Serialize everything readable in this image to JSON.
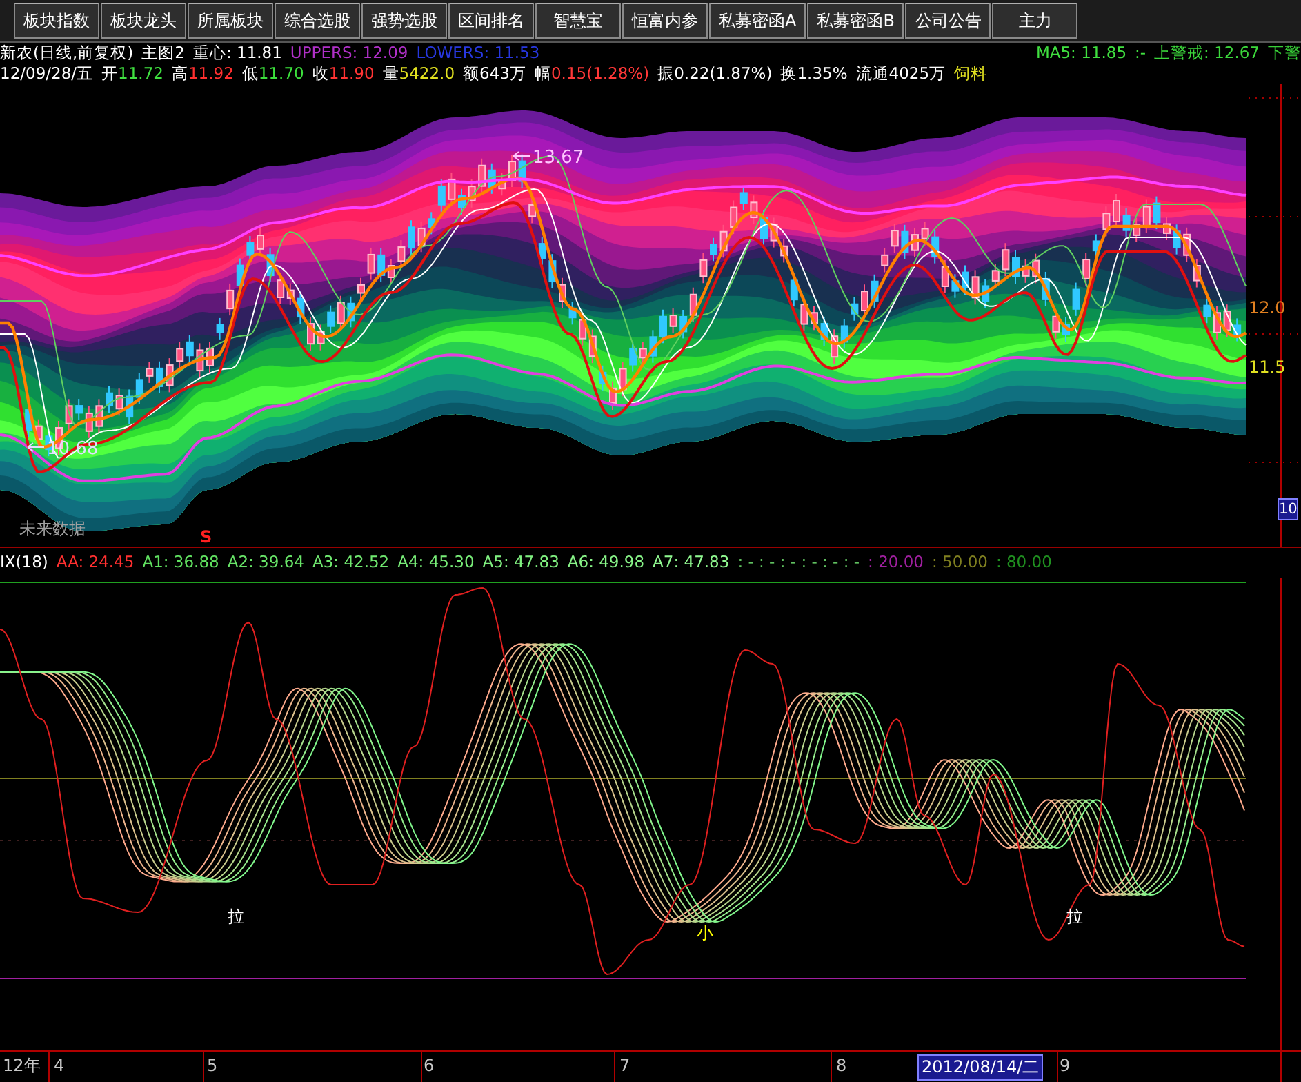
{
  "toolbar": {
    "buttons": [
      {
        "label": "板块指数"
      },
      {
        "label": "板块龙头"
      },
      {
        "label": "所属板块"
      },
      {
        "label": "综合选股"
      },
      {
        "label": "强势选股"
      },
      {
        "label": "区间排名"
      },
      {
        "label": "智慧宝"
      },
      {
        "label": "恒富内参"
      },
      {
        "label": "私募密函A"
      },
      {
        "label": "私募密函B"
      },
      {
        "label": "公司公告"
      },
      {
        "label": "主力"
      }
    ]
  },
  "quote_header": {
    "title": "新农(日线,前复权)",
    "chart_name": "主图2",
    "indicators": [
      {
        "text": "重心: 11.81",
        "color": "#ffffff"
      },
      {
        "text": "UPPERS: 12.09",
        "color": "#b030c8"
      },
      {
        "text": "LOWERS: 11.53",
        "color": "#2838e0"
      }
    ],
    "alerts": [
      {
        "text": "MA5: 11.85",
        "color": "#40e040"
      },
      {
        "text": ":-",
        "color": "#40e040"
      },
      {
        "text": "上警戒: 12.67",
        "color": "#3cd83c"
      },
      {
        "text": "下警",
        "color": "#38d038"
      }
    ]
  },
  "quote_line": {
    "date": "12/09/28/五",
    "fields": [
      {
        "label": "开",
        "value": "11.72",
        "color": "#40e040"
      },
      {
        "label": "高",
        "value": "11.92",
        "color": "#ff3030"
      },
      {
        "label": "低",
        "value": "11.70",
        "color": "#3ce03c"
      },
      {
        "label": "收",
        "value": "11.90",
        "color": "#ff3434"
      },
      {
        "label": "量",
        "value": "5422.0",
        "color": "#e0e020"
      },
      {
        "label": "额",
        "value": "643万",
        "color": "#ffffff"
      },
      {
        "label": "幅",
        "value": "0.15(1.28%)",
        "color": "#ff3838"
      },
      {
        "label": "振",
        "value": "0.22(1.87%)",
        "color": "#fefefe"
      },
      {
        "label": "换",
        "value": "1.35%",
        "color": "#fdfdfd"
      },
      {
        "label": "流通",
        "value": "4025万",
        "color": "#fcfcfc"
      }
    ],
    "industry": "饲料"
  },
  "main_chart": {
    "annotations": [
      {
        "kind": "high",
        "text": "13.67"
      },
      {
        "kind": "low",
        "text": "10.68"
      },
      {
        "kind": "note",
        "text": "未来数据"
      },
      {
        "kind": "signal",
        "text": "S"
      }
    ],
    "axis_labels": [
      {
        "text": "12.0",
        "color": "#e08020"
      },
      {
        "text": "11.5",
        "color": "#e0e020"
      }
    ],
    "current_value": "10"
  },
  "indicator": {
    "name": "IX(18)",
    "readings": [
      {
        "text": "AA: 24.45",
        "color": "#ff3030"
      },
      {
        "text": "A1: 36.88",
        "color": "#60e060"
      },
      {
        "text": "A2: 39.64",
        "color": "#68e468"
      },
      {
        "text": "A3: 42.52",
        "color": "#70e870"
      },
      {
        "text": "A4: 45.30",
        "color": "#78ec78"
      },
      {
        "text": "A5: 47.83",
        "color": "#80f080"
      },
      {
        "text": "A6: 49.98",
        "color": "#88f488"
      },
      {
        "text": "A7: 47.83",
        "color": "#90f890"
      },
      {
        "text": ": - : - : - : - : - : -",
        "color": "#60c060"
      },
      {
        "text": ": 20.00",
        "color": "#a020a0"
      },
      {
        "text": ": 50.00",
        "color": "#808020"
      },
      {
        "text": ": 80.00",
        "color": "#209020"
      }
    ],
    "annotations": [
      {
        "text": "拉",
        "color": "#ffffff"
      },
      {
        "text": "小",
        "color": "#ffff00"
      },
      {
        "text": "拉",
        "color": "#fefefe"
      }
    ]
  },
  "date_axis": {
    "labels": [
      {
        "text": "12年",
        "highlighted": false
      },
      {
        "text": "4",
        "highlighted": false
      },
      {
        "text": "5",
        "highlighted": false
      },
      {
        "text": "6",
        "highlighted": false
      },
      {
        "text": "7",
        "highlighted": false
      },
      {
        "text": "8",
        "highlighted": false
      },
      {
        "text": "2012/08/14/二",
        "highlighted": true
      },
      {
        "text": "9",
        "highlighted": false
      }
    ]
  }
}
